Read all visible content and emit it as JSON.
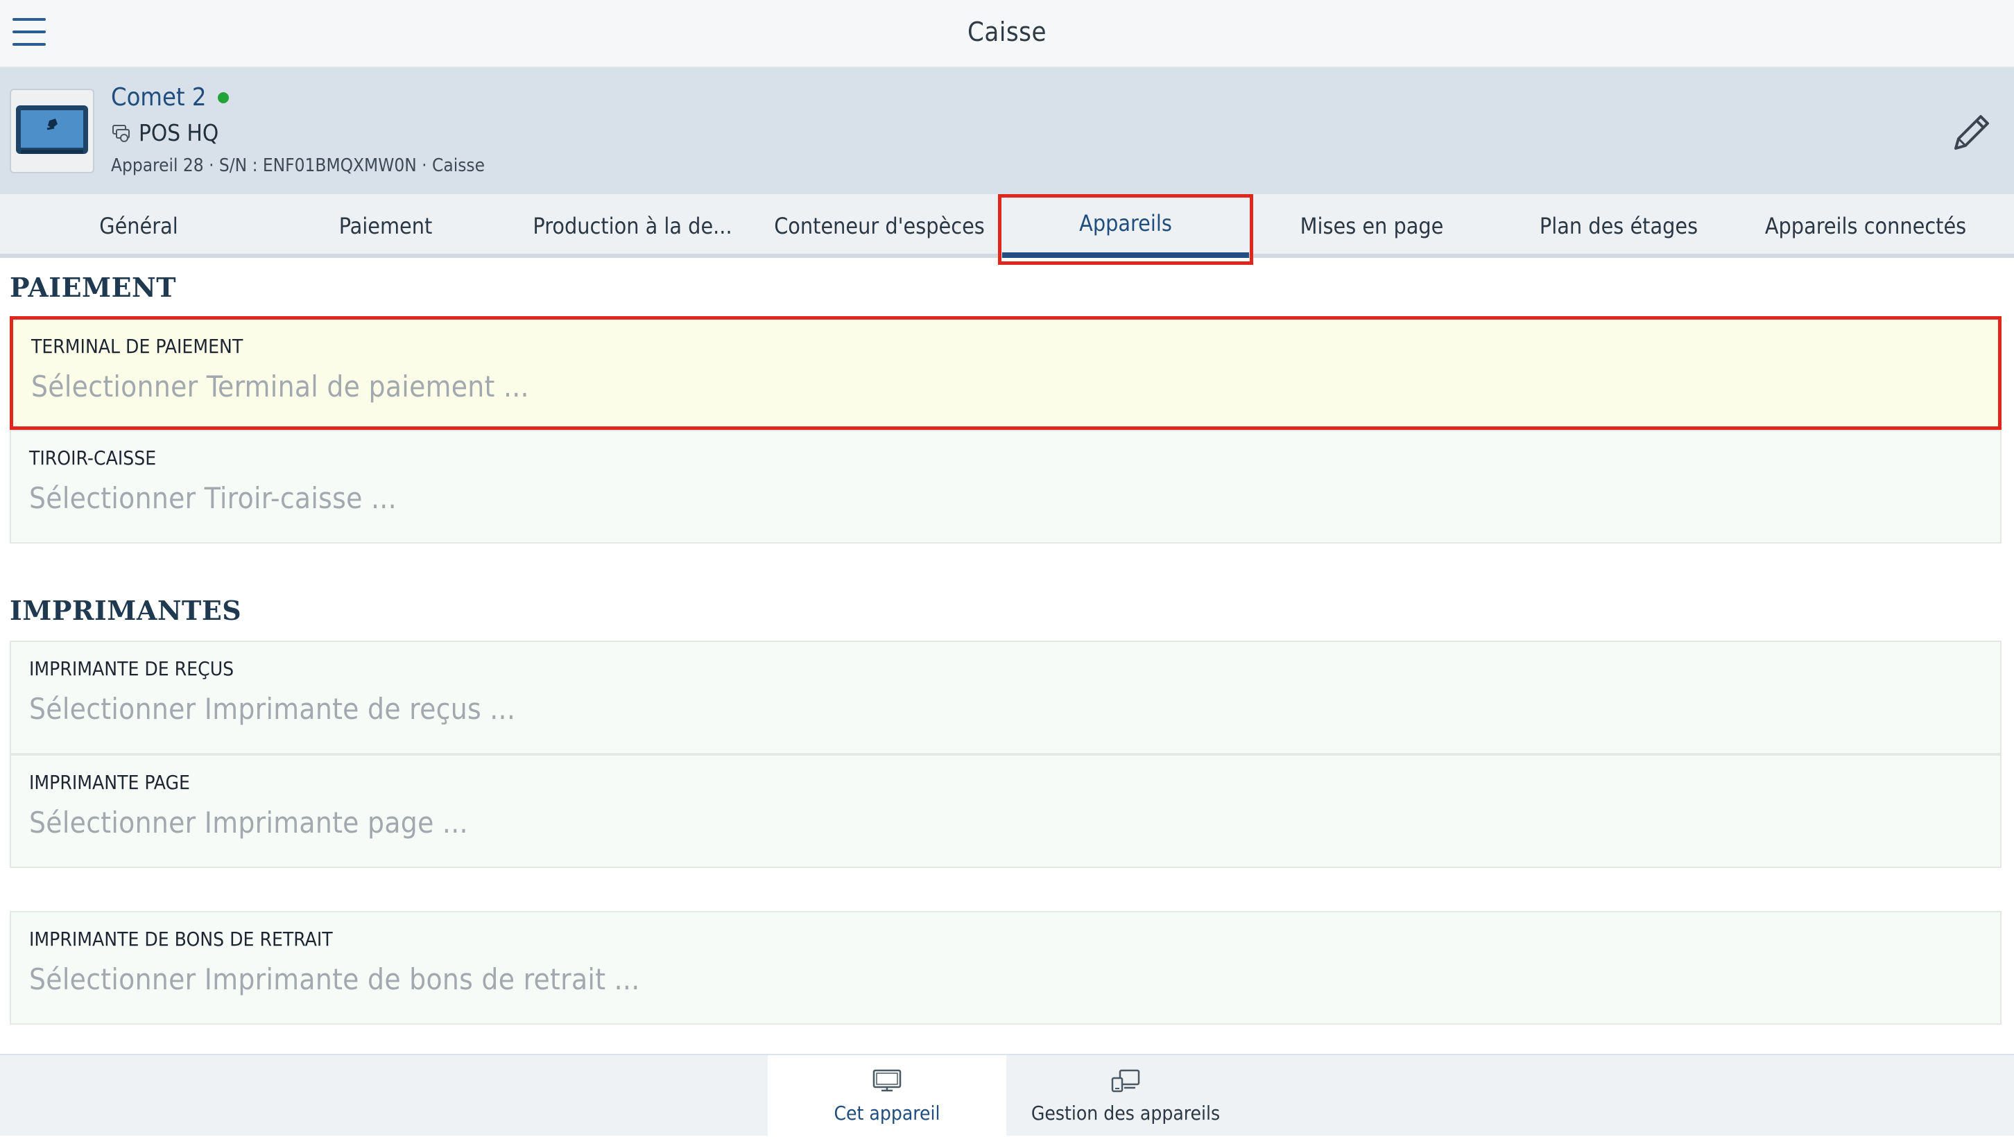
{
  "app": {
    "title": "Caisse"
  },
  "device": {
    "name": "Comet 2",
    "status": "online",
    "location": "POS HQ",
    "meta": "Appareil 28 · S/N : ENF01BMQXMW0N · Caisse"
  },
  "tabs": [
    {
      "label": "Général"
    },
    {
      "label": "Paiement"
    },
    {
      "label": "Production à la de..."
    },
    {
      "label": "Conteneur d'espèces"
    },
    {
      "label": "Appareils",
      "active": true
    },
    {
      "label": "Mises en page"
    },
    {
      "label": "Plan des étages"
    },
    {
      "label": "Appareils connectés"
    }
  ],
  "sections": {
    "payment": {
      "title": "PAIEMENT",
      "fields": [
        {
          "label": "TERMINAL DE PAIEMENT",
          "placeholder": "Sélectionner Terminal de paiement ..."
        },
        {
          "label": "TIROIR-CAISSE",
          "placeholder": "Sélectionner Tiroir-caisse ..."
        }
      ]
    },
    "printers": {
      "title": "IMPRIMANTES",
      "fields": [
        {
          "label": "IMPRIMANTE DE REÇUS",
          "placeholder": "Sélectionner Imprimante de reçus ..."
        },
        {
          "label": "IMPRIMANTE PAGE",
          "placeholder": "Sélectionner Imprimante page ..."
        },
        {
          "label": "IMPRIMANTE DE BONS DE RETRAIT",
          "placeholder": "Sélectionner Imprimante de bons de retrait ..."
        }
      ]
    }
  },
  "bottom_nav": [
    {
      "label": "Cet appareil",
      "icon": "monitor-icon",
      "active": true
    },
    {
      "label": "Gestion des appareils",
      "icon": "devices-icon"
    }
  ],
  "colors": {
    "accent": "#1f4d7d",
    "highlight_border": "#e0271d",
    "online": "#22a33a",
    "header_bg": "#d8e1ea"
  }
}
